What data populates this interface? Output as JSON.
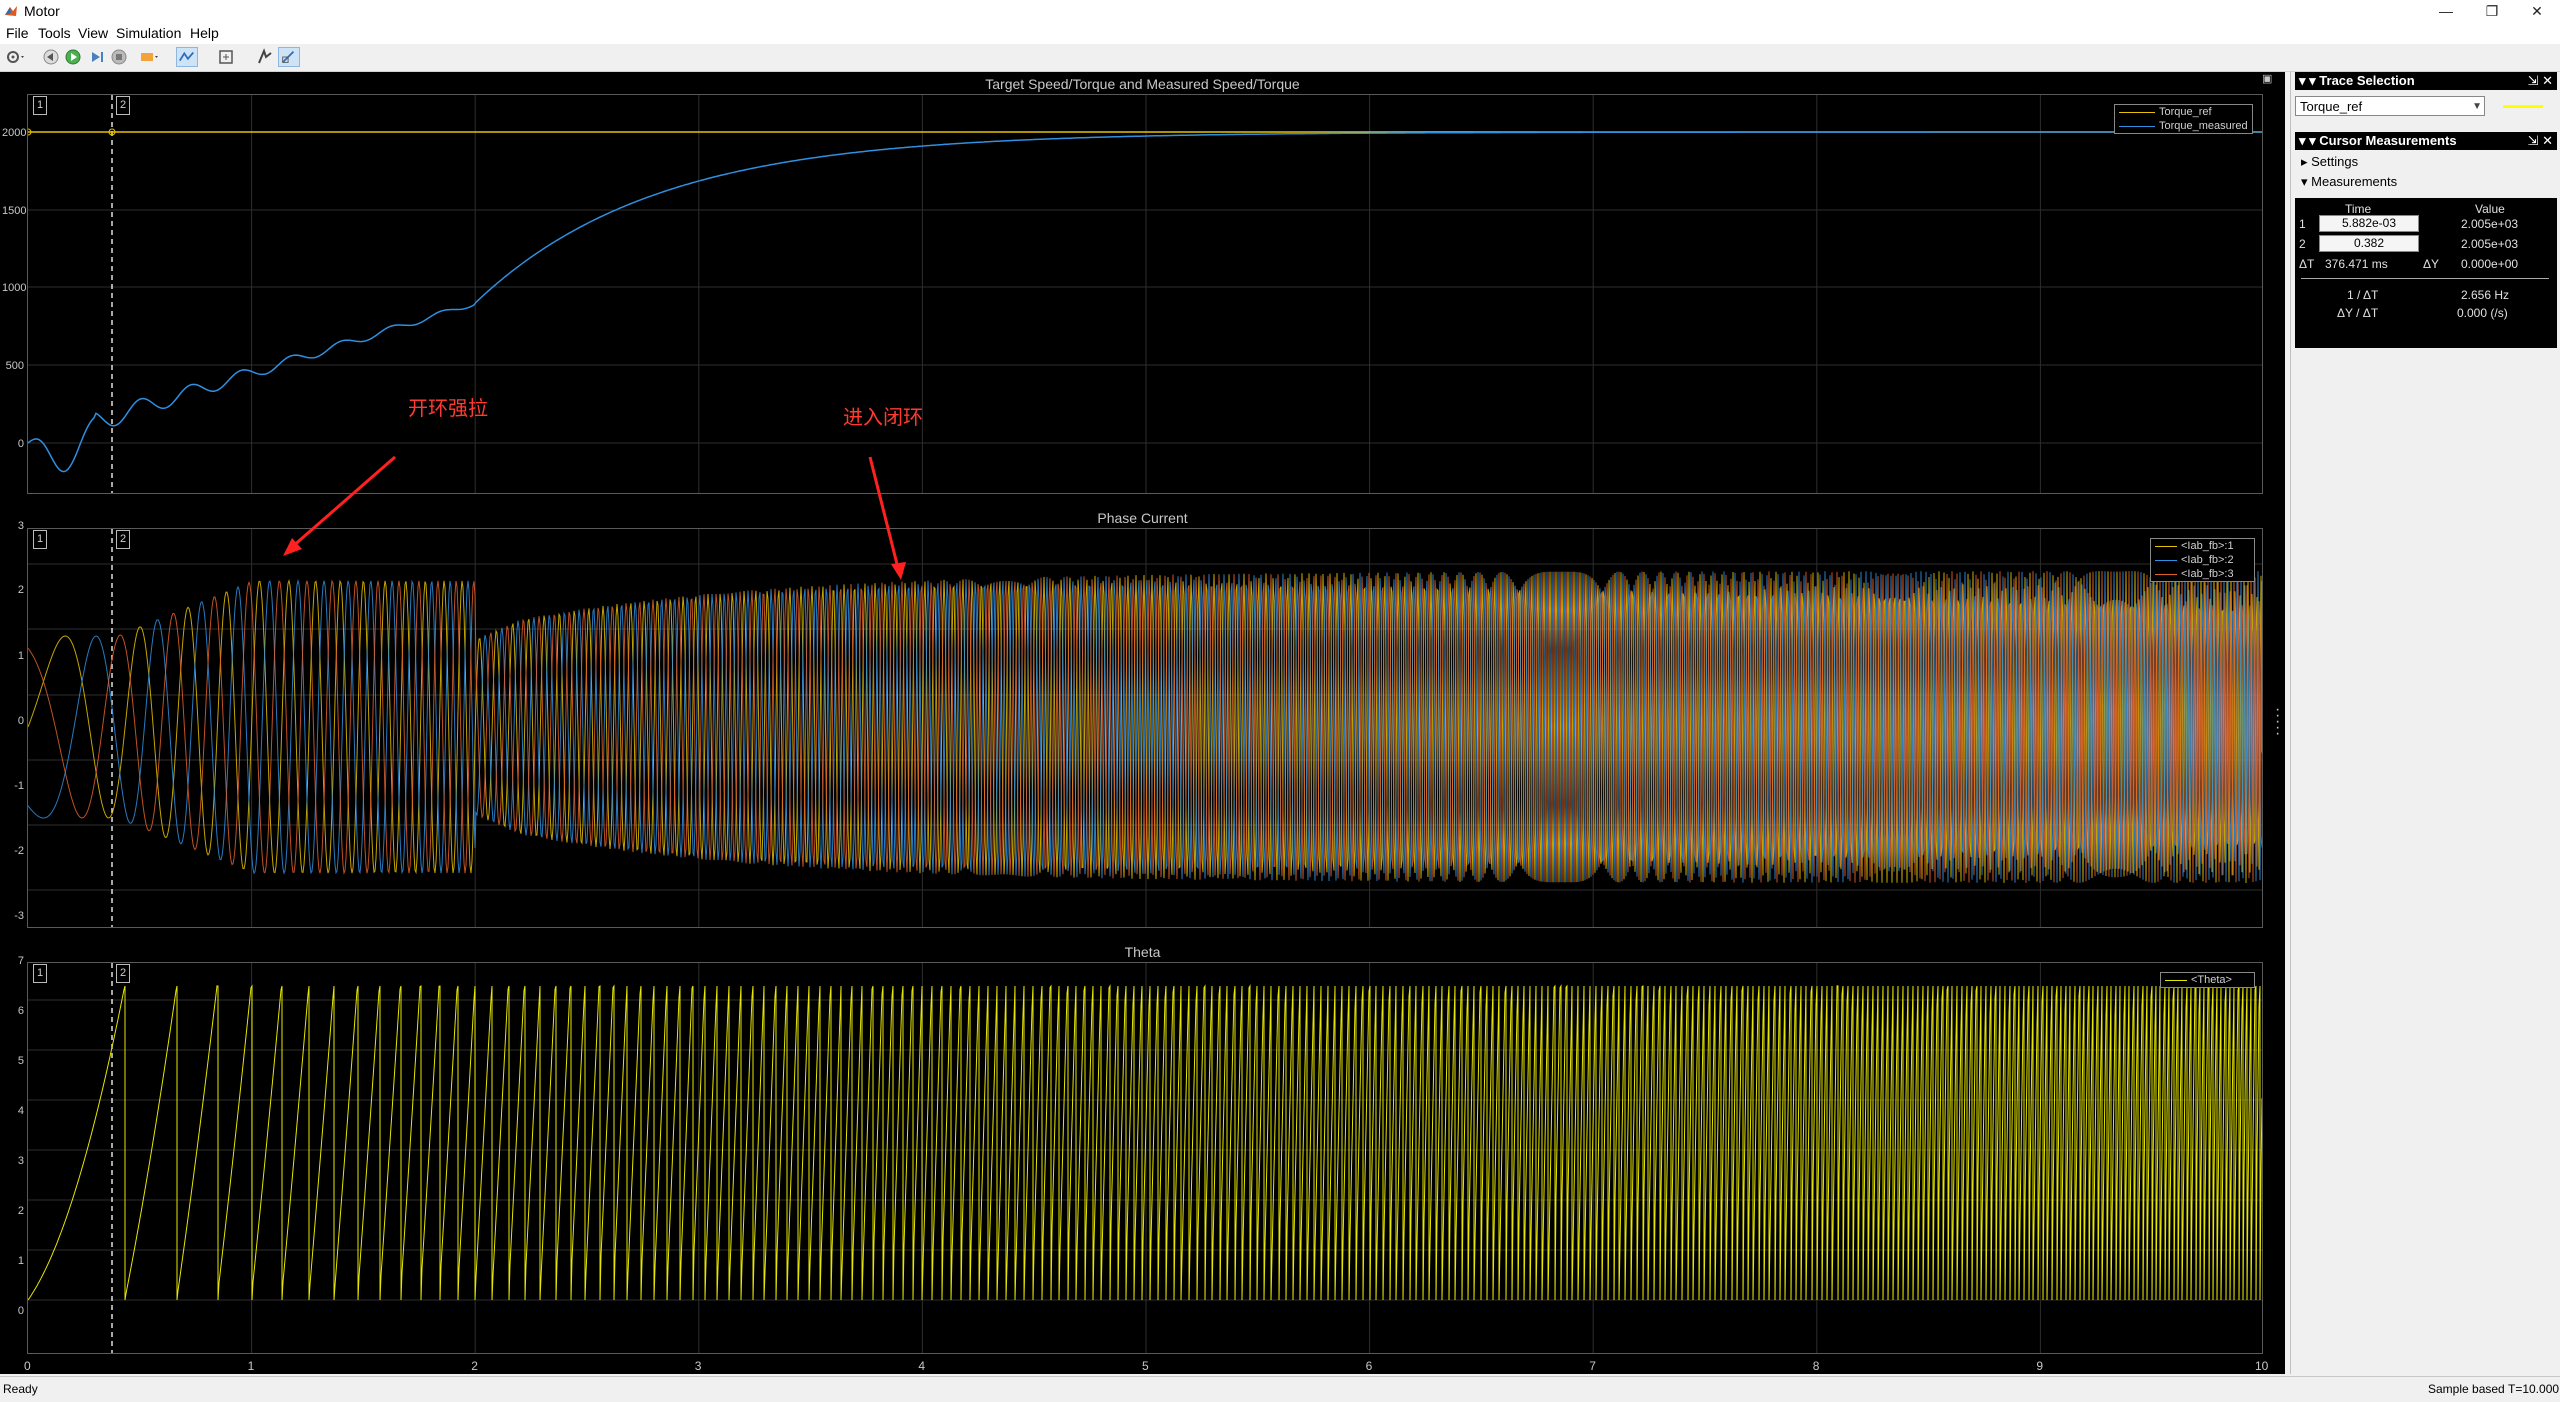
{
  "window": {
    "title": "Motor"
  },
  "menu": [
    "File",
    "Tools",
    "View",
    "Simulation",
    "Help"
  ],
  "toolbar": {
    "icons": [
      "settings-icon",
      "step-back-icon",
      "run-icon",
      "step-forward-icon",
      "stop-icon",
      "highlight-icon",
      "zoom-icon",
      "fit-icon",
      "cursor-icon",
      "measure-icon"
    ]
  },
  "plots": [
    {
      "title": "Target Speed/Torque and Measured Speed/Torque",
      "yticks": [
        "2000",
        "1500",
        "1000",
        "500",
        "0"
      ],
      "legend": [
        {
          "label": "Torque_ref",
          "color": "#e6c200"
        },
        {
          "label": "Torque_measured",
          "color": "#2f8fe0"
        }
      ]
    },
    {
      "title": "Phase Current",
      "yticks": [
        "3",
        "2",
        "1",
        "0",
        "-1",
        "-2",
        "-3"
      ],
      "legend": [
        {
          "label": "<Iab_fb>:1",
          "color": "#e6c200"
        },
        {
          "label": "<Iab_fb>:2",
          "color": "#2f8fe0"
        },
        {
          "label": "<Iab_fb>:3",
          "color": "#e0602a"
        }
      ]
    },
    {
      "title": "Theta",
      "yticks": [
        "7",
        "6",
        "5",
        "4",
        "3",
        "2",
        "1",
        "0"
      ],
      "legend": [
        {
          "label": "<Theta>",
          "color": "#e6e600"
        }
      ]
    }
  ],
  "xticks": [
    "0",
    "1",
    "2",
    "3",
    "4",
    "5",
    "6",
    "7",
    "8",
    "9",
    "10"
  ],
  "cursors": {
    "c1": "1",
    "c2": "2"
  },
  "annotations": {
    "open_loop": "开环强拉",
    "closed_loop": "进入闭环"
  },
  "panel": {
    "trace_selection": {
      "title": "Trace Selection",
      "selected": "Torque_ref",
      "color": "#ffff00"
    },
    "cursor_measurements": {
      "title": "Cursor Measurements",
      "settings": "Settings",
      "measurements": "Measurements",
      "col_time": "Time",
      "col_value": "Value",
      "rows": [
        {
          "idx": "1",
          "time": "5.882e-03",
          "value": "2.005e+03"
        },
        {
          "idx": "2",
          "time": "0.382",
          "value": "2.005e+03"
        }
      ],
      "dT_label": "ΔT",
      "dT": "376.471 ms",
      "dY_label": "ΔY",
      "dY": "0.000e+00",
      "inv_dT_label": "1 / ΔT",
      "inv_dT": "2.656 Hz",
      "dYdT_label": "ΔY / ΔT",
      "dYdT": "0.000 (/s)"
    }
  },
  "status": {
    "left": "Ready",
    "mode": "Sample based",
    "time": "T=10.000"
  }
}
